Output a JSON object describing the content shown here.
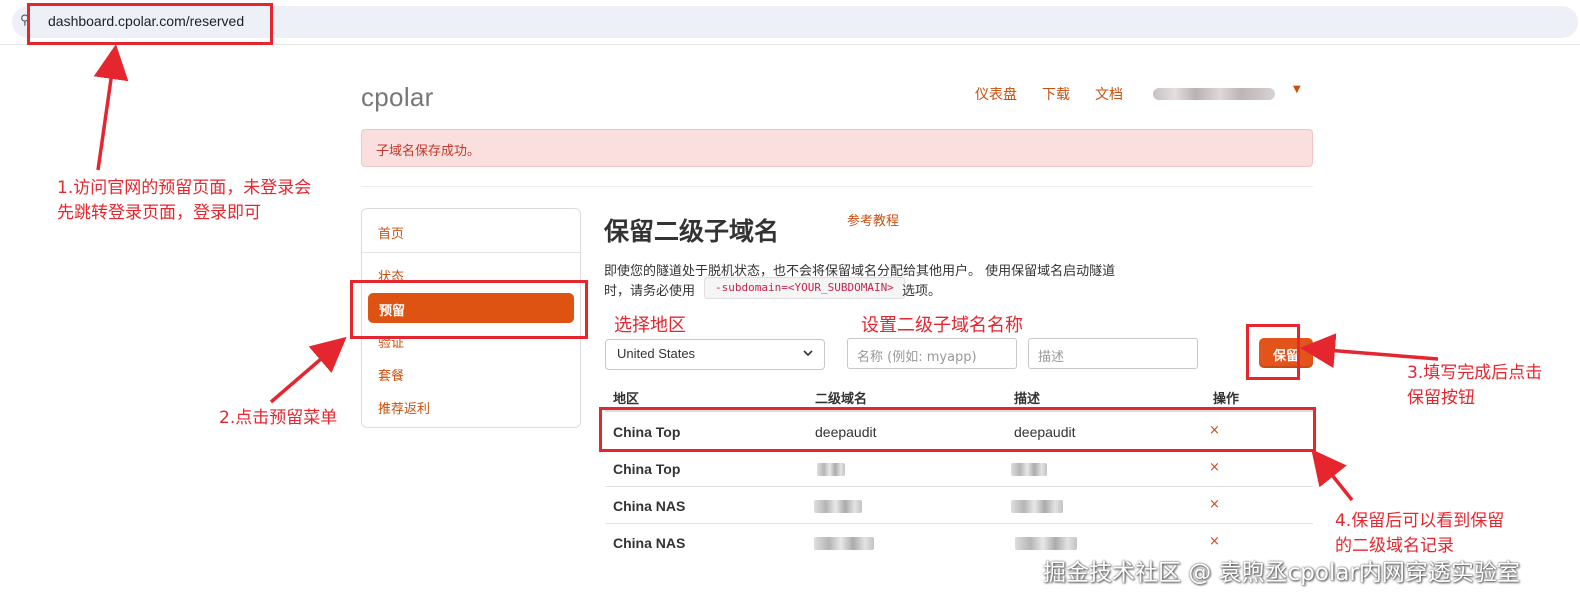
{
  "browser": {
    "url": "dashboard.cpolar.com/reserved",
    "site_icon": "⚲"
  },
  "header": {
    "logo": "cpolar",
    "nav": [
      "仪表盘",
      "下载",
      "文档"
    ],
    "user_caret": "▼"
  },
  "alert": {
    "text": "子域名保存成功。"
  },
  "sidebar": {
    "items": [
      {
        "label": "首页"
      },
      {
        "label": "状态"
      },
      {
        "label": "预留",
        "active": true
      },
      {
        "label": "验证"
      },
      {
        "label": "套餐"
      },
      {
        "label": "推荐返利"
      }
    ]
  },
  "main": {
    "title": "保留二级子域名",
    "tutorial_link": "参考教程",
    "description_line1": "即使您的隧道处于脱机状态，也不会将保留域名分配给其他用户。 使用保留域名启动隧道",
    "description_line2_prefix": "时，请务必使用",
    "description_code": "-subdomain=<YOUR_SUBDOMAIN>",
    "description_line2_suffix": "选项。"
  },
  "form": {
    "region_value": "United States",
    "region_chevron": "⌄",
    "subdomain_placeholder": "名称 (例如: myapp)",
    "description_placeholder": "描述",
    "save_label": "保留"
  },
  "table": {
    "headers": [
      "地区",
      "二级域名",
      "描述",
      "操作"
    ],
    "delete_glyph": "×",
    "rows": [
      {
        "region": "China Top",
        "subdomain": "deepaudit",
        "description": "deepaudit",
        "blurred": false
      },
      {
        "region": "China Top",
        "subdomain": "",
        "description": "",
        "blurred": true
      },
      {
        "region": "China NAS",
        "subdomain": "",
        "description": "",
        "blurred": true
      },
      {
        "region": "China NAS",
        "subdomain": "",
        "description": "",
        "blurred": true
      }
    ]
  },
  "annotations": {
    "step1_line1": "1.访问官网的预留页面，未登录会",
    "step1_line2": "先跳转登录页面，登录即可",
    "step2": "2.点击预留菜单",
    "region_label": "选择地区",
    "subdomain_label": "设置二级子域名名称",
    "step3_line1": "3.填写完成后点击",
    "step3_line2": "保留按钮",
    "step4_line1": "4.保留后可以看到保留",
    "step4_line2": "的二级域名记录",
    "color": "#e5262f"
  },
  "watermark": "掘金技术社区 @ 袁煦丞cpolar内网穿透实验室",
  "colors": {
    "accent": "#c9500f",
    "active_menu": "#df5312",
    "alert_bg": "#fadfde",
    "alert_text": "#c0392b"
  }
}
